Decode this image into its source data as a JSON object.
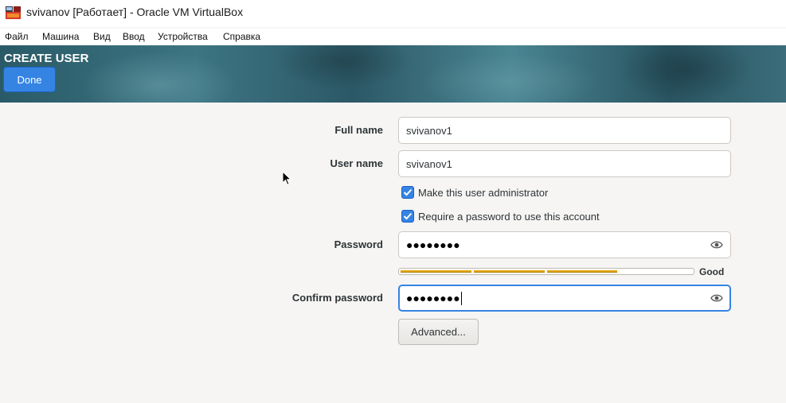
{
  "window": {
    "title": "svivanov [Работает] - Oracle VM VirtualBox"
  },
  "menubar": {
    "items": [
      "Файл",
      "Машина",
      "Вид",
      "Ввод",
      "Устройства",
      "Справка"
    ]
  },
  "header": {
    "title": "CREATE USER",
    "done_label": "Done"
  },
  "form": {
    "full_name": {
      "label": "Full name",
      "value": "svivanov1"
    },
    "user_name": {
      "label": "User name",
      "value": "svivanov1"
    },
    "admin_checkbox": {
      "label": "Make this user administrator",
      "checked": true
    },
    "require_password_checkbox": {
      "label": "Require a password to use this account",
      "checked": true
    },
    "password": {
      "label": "Password",
      "value": "●●●●●●●●"
    },
    "strength": {
      "label": "Good",
      "level": 0.75
    },
    "confirm_password": {
      "label": "Confirm password",
      "value": "●●●●●●●●"
    },
    "advanced_label": "Advanced..."
  },
  "colors": {
    "accent": "#3584e4",
    "strength_bar": "#e5a50a",
    "background": "#f6f5f4"
  },
  "icons": {
    "app": "virtualbox-icon",
    "reveal": "eye-icon",
    "check": "checkmark-icon",
    "pointer": "mouse-pointer-icon"
  }
}
